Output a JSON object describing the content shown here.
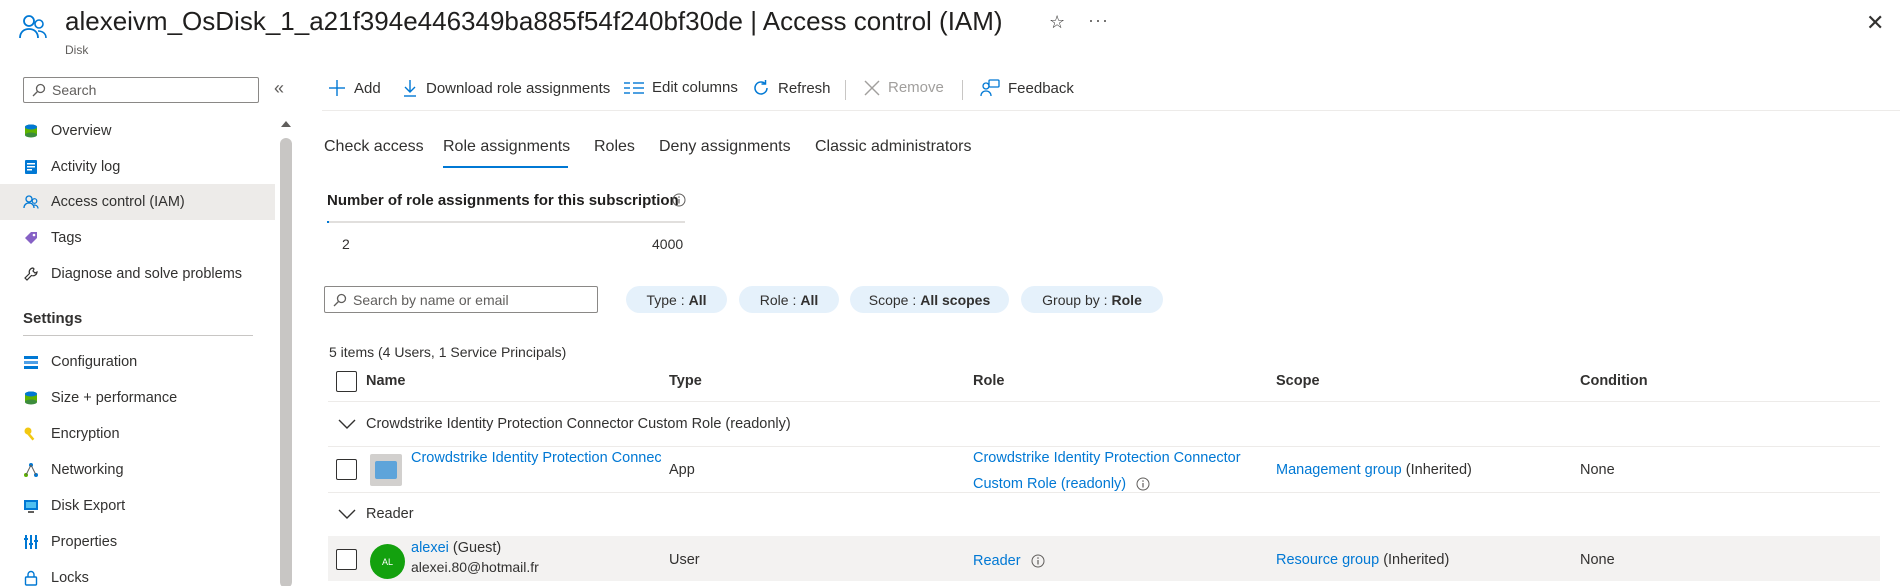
{
  "header": {
    "title": "alexeivm_OsDisk_1_a21f394e446349ba885f54f240bf30de | Access control (IAM)",
    "subtitle": "Disk",
    "star_glyph": "☆",
    "more_glyph": "···",
    "close_glyph": "✕"
  },
  "sidebar": {
    "search_placeholder": "Search",
    "collapse_glyph": "«",
    "items": [
      {
        "label": "Overview",
        "icon": "overview-icon"
      },
      {
        "label": "Activity log",
        "icon": "activity-log-icon"
      },
      {
        "label": "Access control (IAM)",
        "icon": "iam-icon",
        "active": true
      },
      {
        "label": "Tags",
        "icon": "tag-icon"
      },
      {
        "label": "Diagnose and solve problems",
        "icon": "wrench-icon"
      }
    ],
    "settings_heading": "Settings",
    "settings_items": [
      {
        "label": "Configuration",
        "icon": "configuration-icon"
      },
      {
        "label": "Size + performance",
        "icon": "size-performance-icon"
      },
      {
        "label": "Encryption",
        "icon": "key-icon"
      },
      {
        "label": "Networking",
        "icon": "networking-icon"
      },
      {
        "label": "Disk Export",
        "icon": "disk-export-icon"
      },
      {
        "label": "Properties",
        "icon": "properties-icon"
      },
      {
        "label": "Locks",
        "icon": "lock-icon"
      }
    ]
  },
  "toolbar": {
    "add": "Add",
    "download": "Download role assignments",
    "edit_columns": "Edit columns",
    "refresh": "Refresh",
    "remove": "Remove",
    "feedback": "Feedback"
  },
  "tabs": [
    "Check access",
    "Role assignments",
    "Roles",
    "Deny assignments",
    "Classic administrators"
  ],
  "active_tab": "Role assignments",
  "summary": {
    "title": "Number of role assignments for this subscription",
    "current": "2",
    "max": "4000",
    "fraction": 0.0005
  },
  "filters": {
    "search_placeholder": "Search by name or email",
    "pills": [
      {
        "key": "Type :",
        "value": "All"
      },
      {
        "key": "Role :",
        "value": "All"
      },
      {
        "key": "Scope :",
        "value": "All scopes"
      },
      {
        "key": "Group by :",
        "value": "Role"
      }
    ]
  },
  "table": {
    "items_count": "5 items (4 Users, 1 Service Principals)",
    "columns": [
      "Name",
      "Type",
      "Role",
      "Scope",
      "Condition"
    ],
    "groups": [
      {
        "title": "Crowdstrike Identity Protection Connector Custom Role (readonly)",
        "rows": [
          {
            "name": "Crowdstrike Identity Protection Connec",
            "type": "App",
            "role_line1": "Crowdstrike Identity Protection Connector",
            "role_line2": "Custom Role (readonly)",
            "scope_link": "Management group",
            "scope_suffix": "(Inherited)",
            "condition": "None"
          }
        ]
      },
      {
        "title": "Reader",
        "rows": [
          {
            "name": "alexei",
            "name_suffix": "(Guest)",
            "email": "alexei.80@hotmail.fr",
            "avatar_initials": "AL",
            "type": "User",
            "role": "Reader",
            "scope_link": "Resource group",
            "scope_suffix": "(Inherited)",
            "condition": "None"
          }
        ]
      }
    ]
  },
  "colors": {
    "accent": "#0078d4",
    "pill_bg": "#e5f1fb",
    "avatar_green": "#13a10e"
  }
}
